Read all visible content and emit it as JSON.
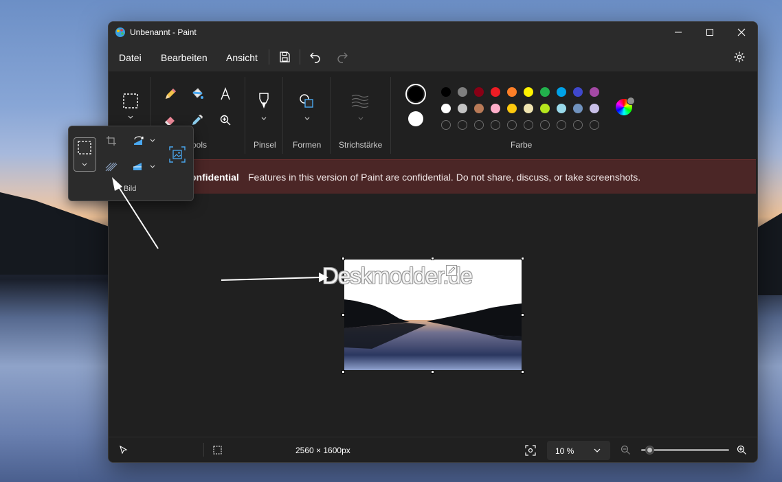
{
  "window": {
    "title": "Unbenannt - Paint",
    "controls": {
      "minimize": "minimize-icon",
      "maximize": "maximize-icon",
      "close": "close-icon"
    }
  },
  "menu": {
    "items": [
      "Datei",
      "Bearbeiten",
      "Ansicht"
    ],
    "toolbar_icons": [
      "save-icon",
      "undo-icon",
      "redo-icon",
      "settings-icon"
    ]
  },
  "ribbon": {
    "groups": {
      "tools": "Tools",
      "brushes": "Pinsel",
      "shapes": "Formen",
      "stroke": "Strichstärke",
      "color": "Farbe"
    },
    "tools_partial_label": "ools",
    "colors": {
      "primary": "#000000",
      "secondary": "#ffffff",
      "row1": [
        "#000000",
        "#7f7f7f",
        "#880015",
        "#ed1c24",
        "#ff7f27",
        "#fff200",
        "#22b14c",
        "#00a2e8",
        "#3f48cc",
        "#a349a4"
      ],
      "row2": [
        "#ffffff",
        "#c3c3c3",
        "#b97a57",
        "#ffaec9",
        "#ffc90e",
        "#efe4b0",
        "#b5e61d",
        "#99d9ea",
        "#7092be",
        "#c8bfe7"
      ]
    }
  },
  "image_popup": {
    "label": "Bild",
    "icons": [
      "select-icon",
      "crop-icon",
      "rotate-icon",
      "resize-icon",
      "flip-icon",
      "image-select-icon"
    ]
  },
  "banner": {
    "title": "Confidential",
    "title_visible": "onfidential",
    "message": "Features in this version of Paint are confidential. Do not share, discuss, or take screenshots."
  },
  "canvas": {
    "watermark": "Deskmodder.de"
  },
  "status": {
    "dimensions": "2560 × 1600px",
    "zoom": "10 %",
    "zoom_level_fraction": 0.05
  }
}
